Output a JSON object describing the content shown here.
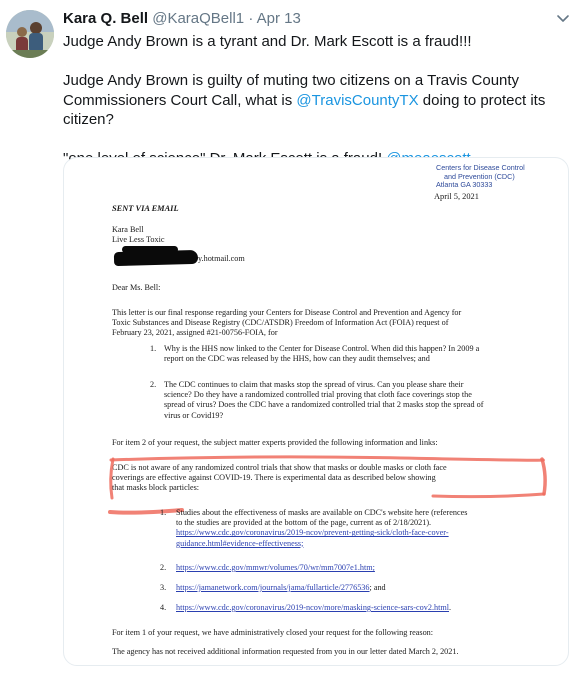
{
  "tweet": {
    "author_name": "Kara Q. Bell",
    "handle": "@KaraQBell1",
    "separator": "·",
    "date": "Apr 13",
    "line1": "Judge Andy Brown is a tyrant and Dr. Mark Escott is a fraud!!!",
    "line2a": "Judge Andy Brown is guilty of muting two citizens on a Travis County",
    "line2b": "Commissioners Court Call, what is ",
    "mention1": "@TravisCountyTX",
    "line2c": " doing to protect its citizen?",
    "line3a": "\"one level of science\" Dr. Mark Escott is a fraud! ",
    "mention2": "@meaescott"
  },
  "document": {
    "cdc_header": [
      "Centers for Disease Control",
      "and Prevention (CDC)",
      "Atlanta GA 30333"
    ],
    "date": "April 5, 2021",
    "sent_via": "SENT VIA EMAIL",
    "addressee": [
      "Kara Bell",
      "Live Less Toxic"
    ],
    "email_tail": "y.hotmail.com",
    "salutation": "Dear Ms. Bell:",
    "intro": [
      "This letter is our final response regarding your Centers for Disease Control and Prevention and Agency for",
      "Toxic Substances and Disease Registry (CDC/ATSDR) Freedom of Information Act (FOIA) request of",
      "February 23, 2021, assigned #21-00756-FOIA, for"
    ],
    "item1_num": "1.",
    "item1": [
      "Why is the HHS now linked to the Center for Disease Control. When did this happen? In 2009 a",
      "report on the CDC was released by the HHS, how can they audit themselves; and"
    ],
    "item2_num": "2.",
    "item2": [
      "The CDC continues to claim that masks stop the spread of virus. Can you please share their",
      "science? Do they have a randomized controlled trial proving that cloth face coverings stop the",
      "spread of virus? Does the CDC have a randomized controlled trial that 2 masks stop the spread of",
      "virus or Covid19?"
    ],
    "item2_intro": "For item 2 of your request, the subject matter experts provided the following information and links:",
    "cdc_statement": [
      "CDC is not aware of any randomized control trials that show that masks or double masks or cloth face",
      "coverings are effective against COVID-19. There is experimental data as described below showing",
      "that masks block particles:"
    ],
    "list_num1": "1.",
    "list1": [
      "Studies about the effectiveness of masks are available on CDC's website here (references",
      "to the studies are provided at the bottom of the page, current as of 2/18/2021)."
    ],
    "link1": [
      "https://www.cdc.gov/coronavirus/2019-ncov/prevent-getting-sick/cloth-face-cover-",
      "guidance.html#evidence-effectiveness;"
    ],
    "list_num2": "2.",
    "link2": "https://www.cdc.gov/mmwr/volumes/70/wr/mm7007e1.htm;",
    "list_num3": "3.",
    "link3": "https://jamanetwork.com/journals/jama/fullarticle/2776536",
    "link3_tail": "; and",
    "list_num4": "4.",
    "link4": "https://www.cdc.gov/coronavirus/2019-ncov/more/masking-science-sars-cov2.html",
    "link4_tail": ".",
    "item1_close": "For item 1 of your request, we have administratively closed your request for the following reason:",
    "closing": "The agency has not received additional information requested from you in our letter dated March 2, 2021."
  },
  "colors": {
    "link": "#1b95e0",
    "handle": "#657786",
    "highlight": "#ef6c5e",
    "doc_link": "#2a3fb0"
  },
  "icons": {
    "caret": "chevron-down-icon"
  }
}
